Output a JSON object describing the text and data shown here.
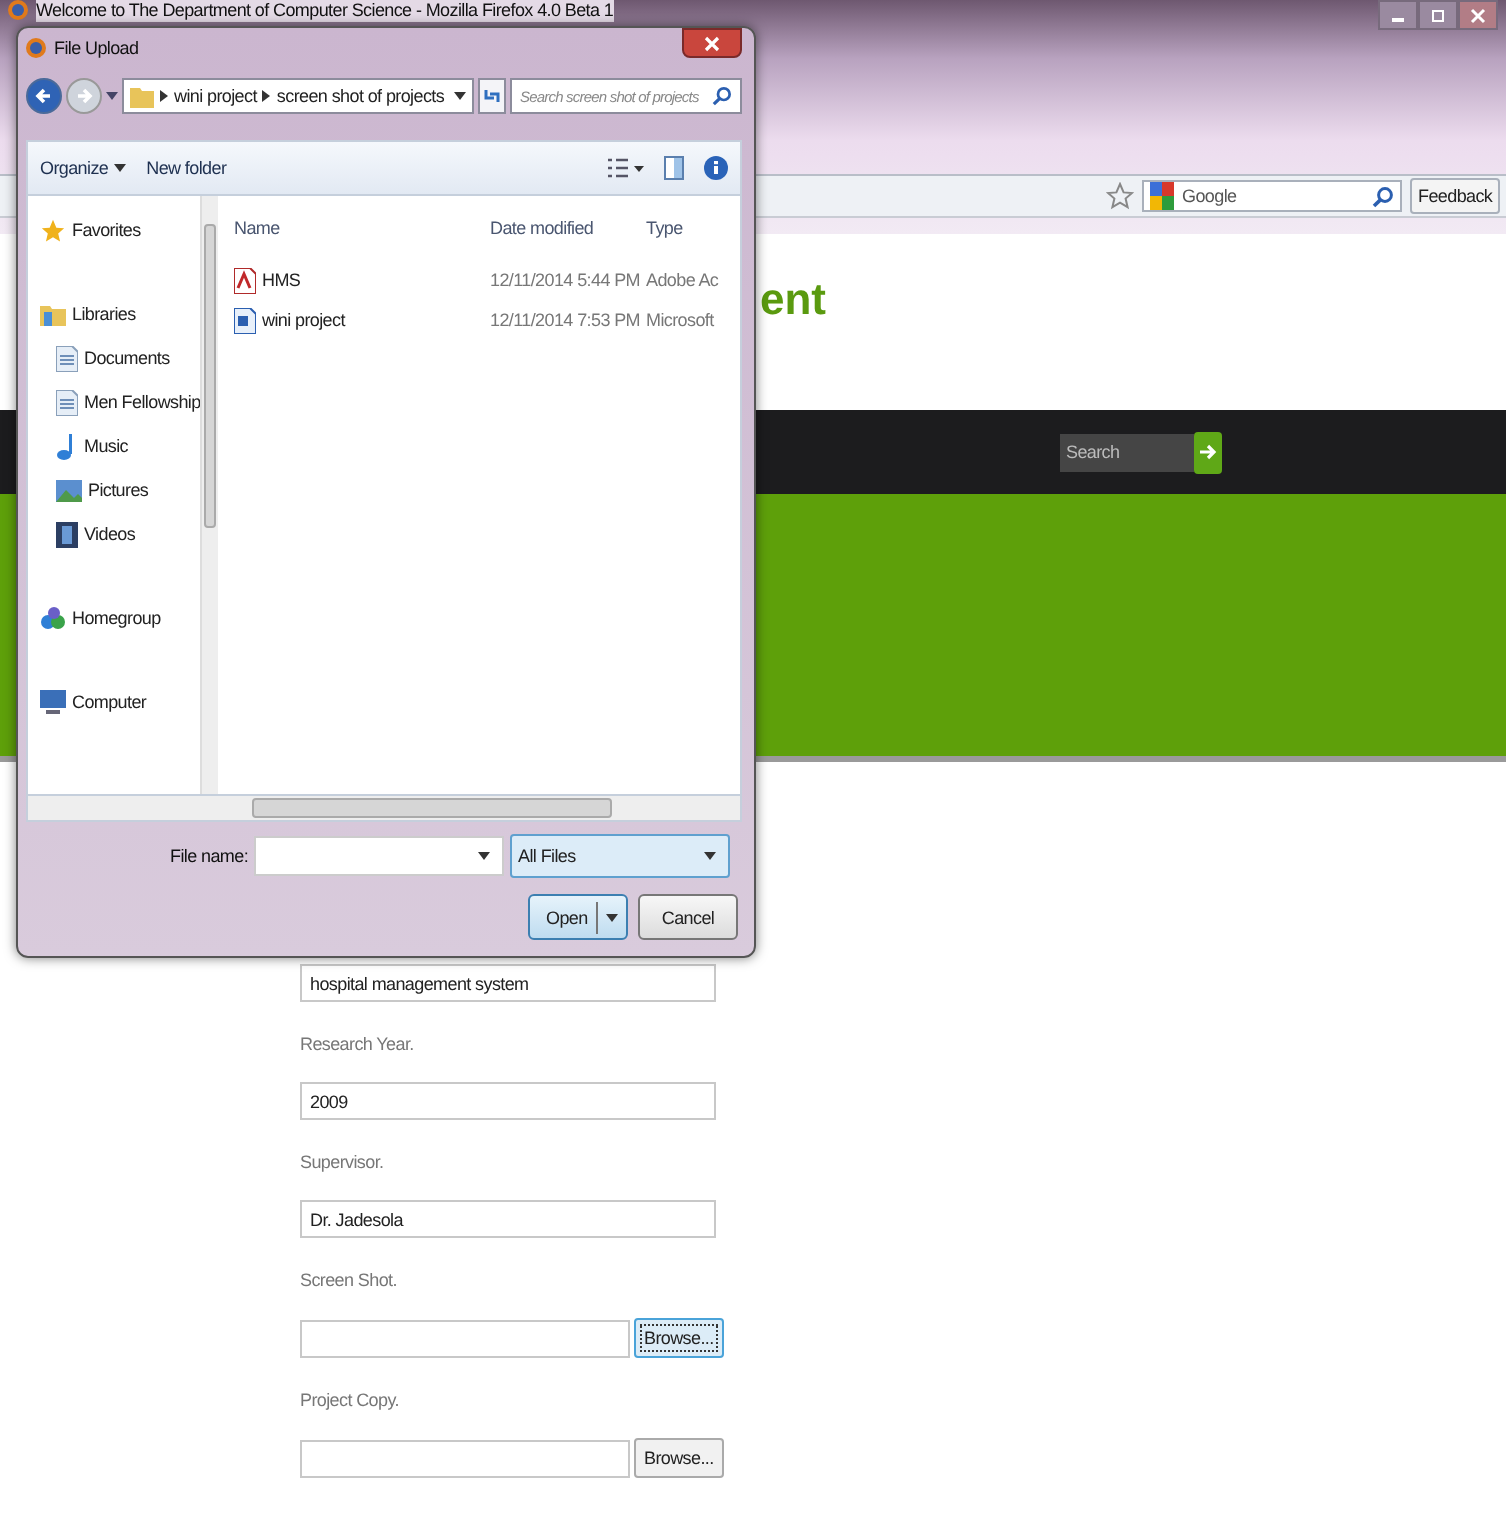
{
  "browser": {
    "title": "Welcome to The Department of Computer Science - Mozilla Firefox 4.0 Beta 1",
    "search_engine": "Google",
    "feedback_button": "Feedback"
  },
  "page": {
    "heading": "ent",
    "search": {
      "placeholder": "Search"
    },
    "form": [
      {
        "kind": "text",
        "value": "hospital management system"
      },
      {
        "kind": "text",
        "label": "Research Year.",
        "value": "2009"
      },
      {
        "kind": "text",
        "label": "Supervisor.",
        "value": "Dr. Jadesola"
      },
      {
        "kind": "file",
        "label": "Screen Shot.",
        "button": "Browse...",
        "focused": true
      },
      {
        "kind": "file",
        "label": "Project Copy.",
        "button": "Browse...",
        "focused": false
      }
    ]
  },
  "dialog": {
    "title": "File Upload",
    "breadcrumb": [
      "wini project",
      "screen shot of projects"
    ],
    "search": {
      "placeholder": "Search screen shot of projects"
    },
    "toolbar": [
      {
        "label": "Organize",
        "menu": true
      },
      {
        "label": "New folder",
        "menu": false
      }
    ],
    "nav": [
      {
        "label": "Favorites",
        "kind": "favorites"
      },
      {
        "label": "Libraries",
        "kind": "libraries",
        "children": [
          {
            "label": "Documents",
            "kind": "documents"
          },
          {
            "label": "Men Fellowship",
            "kind": "documents"
          },
          {
            "label": "Music",
            "kind": "music"
          },
          {
            "label": "Pictures",
            "kind": "pictures"
          },
          {
            "label": "Videos",
            "kind": "videos"
          }
        ]
      },
      {
        "label": "Homegroup",
        "kind": "homegroup"
      },
      {
        "label": "Computer",
        "kind": "computer"
      }
    ],
    "columns": [
      "Name",
      "Date modified",
      "Type"
    ],
    "files": [
      {
        "name": "HMS",
        "kind": "pdf",
        "date": "12/11/2014 5:44 PM",
        "type": "Adobe Ac"
      },
      {
        "name": "wini project",
        "kind": "doc",
        "date": "12/11/2014 7:53 PM",
        "type": "Microsoft"
      }
    ],
    "file_name_label": "File name:",
    "file_type": "All Files",
    "open_button": "Open",
    "cancel_button": "Cancel"
  }
}
